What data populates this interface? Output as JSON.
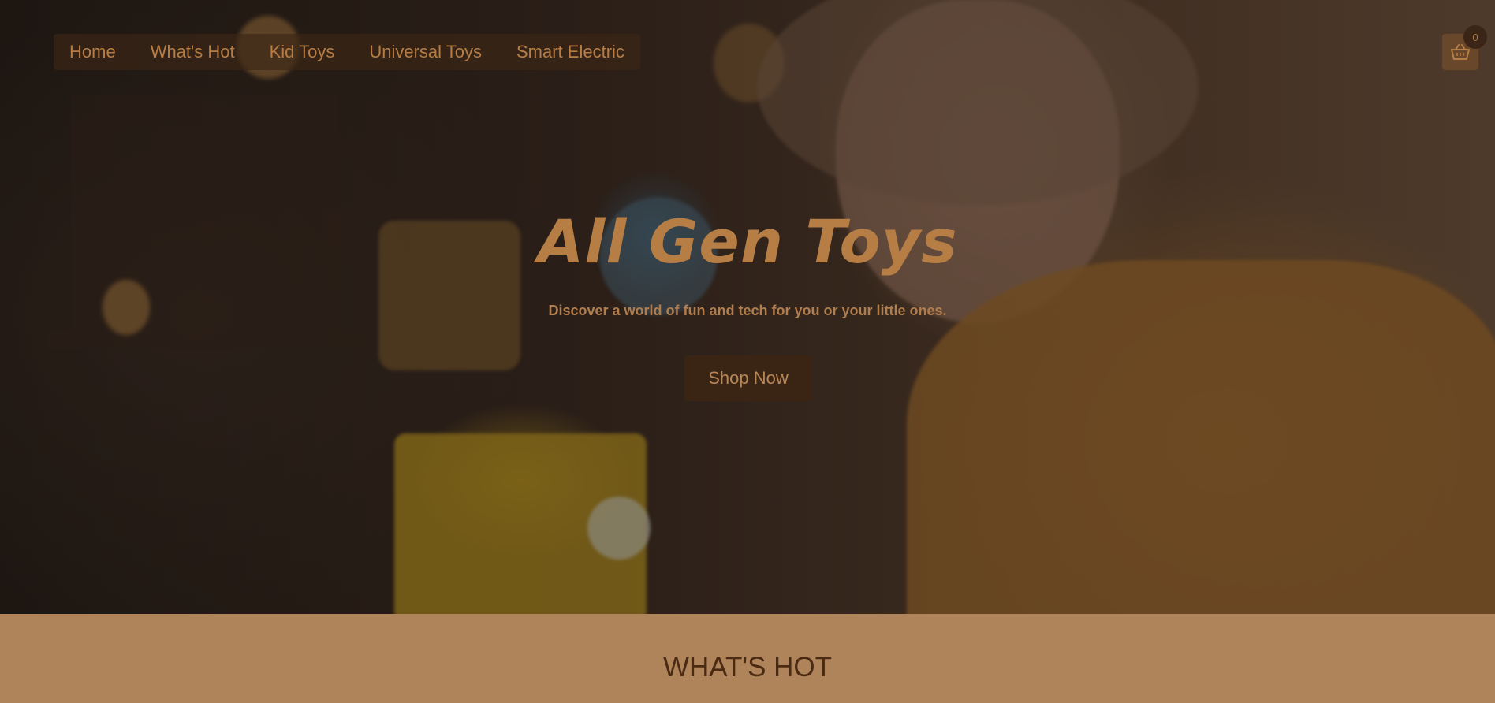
{
  "nav": {
    "items": [
      {
        "label": "Home"
      },
      {
        "label": "What's Hot"
      },
      {
        "label": "Kid Toys"
      },
      {
        "label": "Universal Toys"
      },
      {
        "label": "Smart Electric"
      }
    ]
  },
  "cart": {
    "icon": "basket-icon",
    "count": "0"
  },
  "hero": {
    "title": "All Gen Toys",
    "subtitle": "Discover a world of fun and tech for you or your little ones.",
    "cta_label": "Shop Now"
  },
  "section": {
    "title": "WHAT'S HOT"
  },
  "colors": {
    "accent": "#b67e45",
    "section_bg": "#b0845a",
    "heading_dark": "#4a2a12",
    "button_bg": "#3a2414"
  }
}
